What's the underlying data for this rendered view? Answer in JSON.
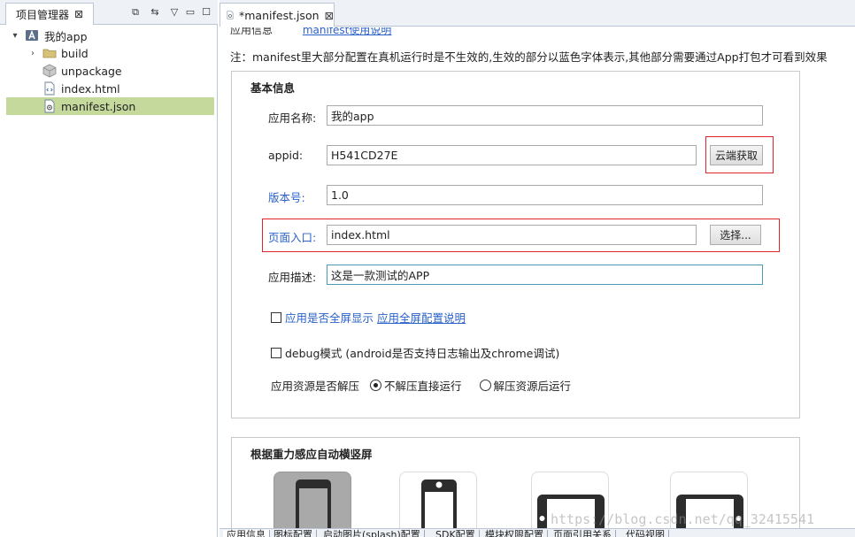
{
  "left_panel": {
    "tab_label": "项目管理器",
    "tree": {
      "project": "我的app",
      "items": [
        "build",
        "unpackage",
        "index.html",
        "manifest.json"
      ]
    }
  },
  "editor": {
    "tab_label": "*manifest.json",
    "cut_top_left": "应用信息",
    "cut_top_link": "manifest使用说明",
    "note": "注：manifest里大部分配置在真机运行时是不生效的,生效的部分以蓝色字体表示,其他部分需要通过App打包才可看到效果",
    "basic": {
      "title": "基本信息",
      "app_name_label": "应用名称:",
      "app_name_value": "我的app",
      "appid_label": "appid:",
      "appid_value": "H541CD27E",
      "cloud_button": "云端获取",
      "version_label": "版本号:",
      "version_value": "1.0",
      "entry_label": "页面入口:",
      "entry_value": "index.html",
      "select_button": "选择...",
      "desc_label": "应用描述:",
      "desc_value": "这是一款测试的APP",
      "fullscreen_label": "应用是否全屏显示",
      "fullscreen_link": "应用全屏配置说明",
      "debug_label": "debug模式 (android是否支持日志输出及chrome调试)",
      "unzip_label": "应用资源是否解压",
      "unzip_options": [
        "不解压直接运行",
        "解压资源后运行"
      ],
      "unzip_selected": 0
    },
    "orientation": {
      "title": "根据重力感应自动横竖屏"
    },
    "bottom_tabs": [
      "应用信息",
      "图标配置",
      "启动图片(splash)配置",
      "SDK配置",
      "模块权限配置",
      "页面引用关系",
      "代码视图"
    ],
    "active_bottom_tab": 0
  },
  "watermark": "https://blog.csdn.net/qq_32415541",
  "colors": {
    "selection_green": "#c5d99c",
    "link_blue": "#2a62c9",
    "highlight_red": "#e0242a"
  }
}
